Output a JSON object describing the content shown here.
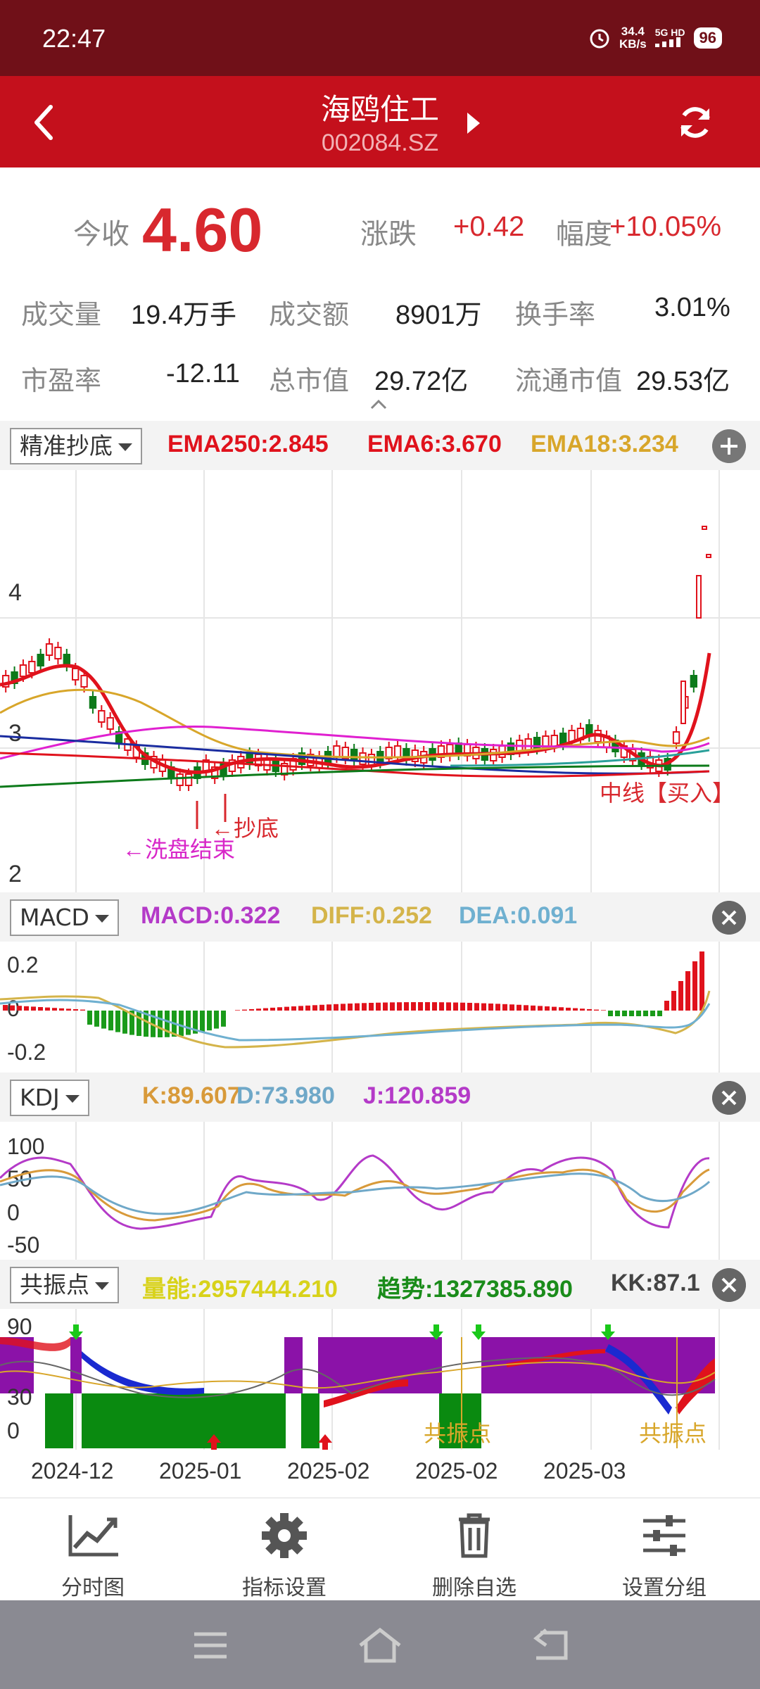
{
  "status": {
    "time": "22:47",
    "net_speed_value": "34.4",
    "net_speed_unit": "KB/s",
    "network": "5G HD",
    "battery": "96"
  },
  "header": {
    "stock_name": "海鸥住工",
    "stock_code": "002084.SZ"
  },
  "quote": {
    "close_label": "今收",
    "close_value": "4.60",
    "change_label": "涨跌",
    "change_value": "+0.42",
    "amplitude_label": "幅度",
    "amplitude_value": "+10.05%",
    "volume_label": "成交量",
    "volume_value": "19.4万手",
    "turnover_label": "成交额",
    "turnover_value": "8901万",
    "rate_label": "换手率",
    "rate_value": "3.01%",
    "pe_label": "市盈率",
    "pe_value": "-12.11",
    "mcap_label": "总市值",
    "mcap_value": "29.72亿",
    "float_label": "流通市值",
    "float_value": "29.53亿"
  },
  "main_panel": {
    "selector": "精准抄底",
    "indicators": [
      {
        "text": "EMA250:2.845",
        "color": "#e0121c"
      },
      {
        "text": "EMA6:3.670",
        "color": "#e0121c"
      },
      {
        "text": "EMA18:3.234",
        "color": "#d8a62a"
      }
    ],
    "y_ticks": [
      "4",
      "3",
      "2"
    ],
    "annotations": {
      "bottom": "←抄底",
      "wash": "←洗盘结束",
      "buy": "中线【买入】"
    }
  },
  "macd_panel": {
    "selector": "MACD",
    "indicators": [
      {
        "text": "MACD:0.322",
        "color": "#b43ac8"
      },
      {
        "text": "DIFF:0.252",
        "color": "#d4b44a"
      },
      {
        "text": "DEA:0.091",
        "color": "#6fb0d0"
      }
    ],
    "y_ticks": [
      "0.2",
      "0",
      "-0.2"
    ]
  },
  "kdj_panel": {
    "selector": "KDJ",
    "indicators": [
      {
        "text": "K:89.607",
        "color": "#d89a3a"
      },
      {
        "text": "D:73.980",
        "color": "#6fa8c8"
      },
      {
        "text": "J:120.859",
        "color": "#b43ac8"
      }
    ],
    "y_ticks": [
      "100",
      "50",
      "0",
      "-50"
    ]
  },
  "resonance_panel": {
    "selector": "共振点",
    "indicators": [
      {
        "text": "量能:2957444.210",
        "color": "#d8d21a"
      },
      {
        "text": "趋势:1327385.890",
        "color": "#1a8c1a"
      },
      {
        "text": "KK:87.1",
        "color": "#444444"
      }
    ],
    "y_ticks": [
      "90",
      "30",
      "0"
    ],
    "labels": [
      "共振点",
      "共振点"
    ]
  },
  "x_axis": [
    "2024-12",
    "2025-01",
    "2025-02",
    "2025-02",
    "2025-03"
  ],
  "bottom_nav": [
    {
      "label": "分时图",
      "icon": "chart-line-icon"
    },
    {
      "label": "指标设置",
      "icon": "gear-icon"
    },
    {
      "label": "删除自选",
      "icon": "trash-icon"
    },
    {
      "label": "设置分组",
      "icon": "sliders-icon"
    }
  ]
}
